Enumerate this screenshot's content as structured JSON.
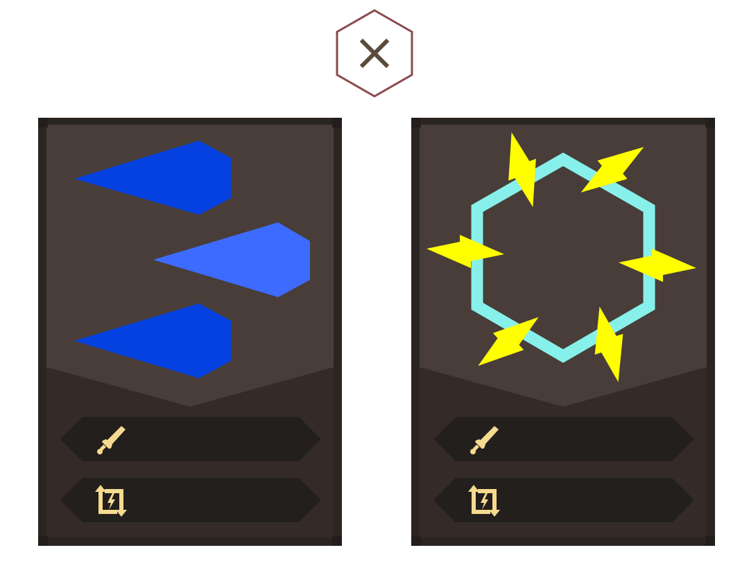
{
  "close_button": {
    "icon": "close-icon",
    "border_color": "#8b4a4e",
    "icon_color": "#5a4b3c"
  },
  "cards": [
    {
      "id": "left",
      "art": "blue-shards",
      "art_colors": [
        "#0541e0",
        "#3d6bff",
        "#0541e0"
      ],
      "stats": [
        {
          "icon": "sword-icon",
          "label": ""
        },
        {
          "icon": "swap-lightning-icon",
          "label": ""
        }
      ]
    },
    {
      "id": "right",
      "art": "lightning-hex-ring",
      "art_colors": [
        "#88f0ea",
        "#ffff00"
      ],
      "stats": [
        {
          "icon": "sword-icon",
          "label": ""
        },
        {
          "icon": "swap-lightning-icon",
          "label": ""
        }
      ]
    }
  ],
  "theme": {
    "card_border": "#2b2522",
    "card_top": "#483d39",
    "card_bottom": "#342b28",
    "stat_bg": "#221f1d",
    "icon_color": "#f6da8f"
  }
}
